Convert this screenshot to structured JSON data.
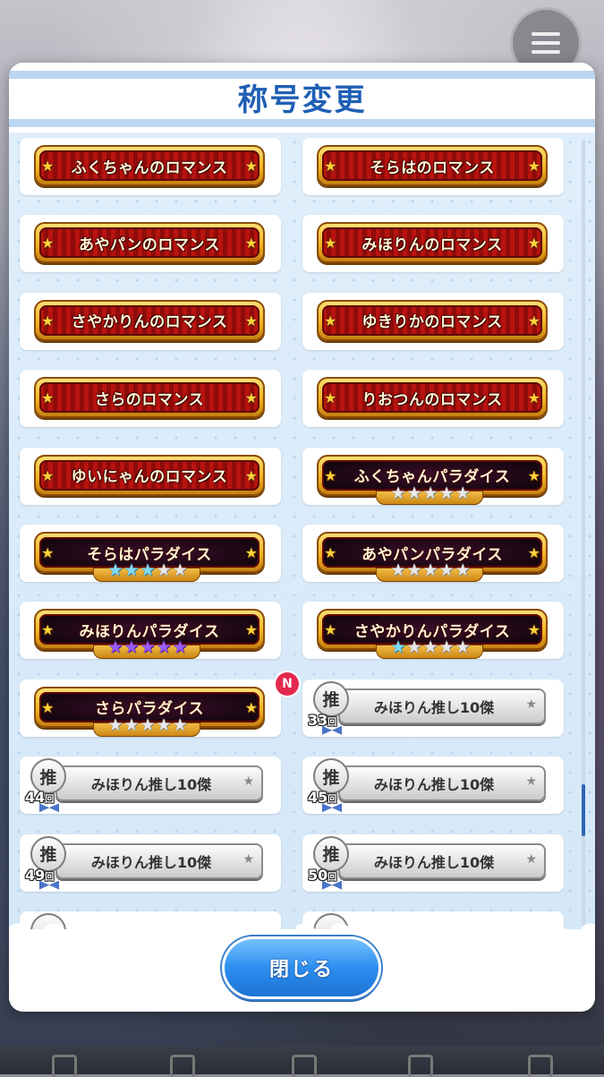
{
  "dialog": {
    "title": "称号変更",
    "close_label": "閉じる"
  },
  "titles": [
    {
      "label": "ふくちゃんのロマンス",
      "type": "romance"
    },
    {
      "label": "そらはのロマンス",
      "type": "romance"
    },
    {
      "label": "あやパンのロマンス",
      "type": "romance"
    },
    {
      "label": "みほりんのロマンス",
      "type": "romance"
    },
    {
      "label": "さやかりんのロマンス",
      "type": "romance"
    },
    {
      "label": "ゆきりかのロマンス",
      "type": "romance"
    },
    {
      "label": "さらのロマンス",
      "type": "romance"
    },
    {
      "label": "りおつんのロマンス",
      "type": "romance"
    },
    {
      "label": "ゆいにゃんのロマンス",
      "type": "romance"
    },
    {
      "label": "ふくちゃんパラダイス",
      "type": "paradise",
      "stars": [
        "white",
        "white",
        "white",
        "white",
        "white"
      ]
    },
    {
      "label": "そらはパラダイス",
      "type": "paradise",
      "stars": [
        "blue",
        "blue",
        "blue",
        "white",
        "white"
      ]
    },
    {
      "label": "あやパンパラダイス",
      "type": "paradise",
      "stars": [
        "white",
        "white",
        "white",
        "white",
        "white"
      ]
    },
    {
      "label": "みほりんパラダイス",
      "type": "paradise",
      "stars": [
        "purple",
        "purple",
        "purple",
        "purple",
        "purple"
      ]
    },
    {
      "label": "さやかりんパラダイス",
      "type": "paradise",
      "stars": [
        "blue",
        "white",
        "white",
        "white",
        "white"
      ]
    },
    {
      "label": "さらパラダイス",
      "type": "paradise",
      "stars": [
        "white",
        "white",
        "white",
        "white",
        "white"
      ],
      "new_badge": "N"
    },
    {
      "label": "みほりん推し10傑",
      "type": "oshi",
      "badge_char": "推",
      "count": "33",
      "count_unit": "回"
    },
    {
      "label": "みほりん推し10傑",
      "type": "oshi",
      "badge_char": "推",
      "count": "44",
      "count_unit": "回"
    },
    {
      "label": "みほりん推し10傑",
      "type": "oshi",
      "badge_char": "推",
      "count": "45",
      "count_unit": "回"
    },
    {
      "label": "みほりん推し10傑",
      "type": "oshi",
      "badge_char": "推",
      "count": "49",
      "count_unit": "回"
    },
    {
      "label": "みほりん推し10傑",
      "type": "oshi",
      "badge_char": "推",
      "count": "50",
      "count_unit": "回"
    }
  ],
  "colors": {
    "title_blue": "#1f5fb4",
    "close_button": "#2c8ef0",
    "new_badge": "#e4294f"
  }
}
